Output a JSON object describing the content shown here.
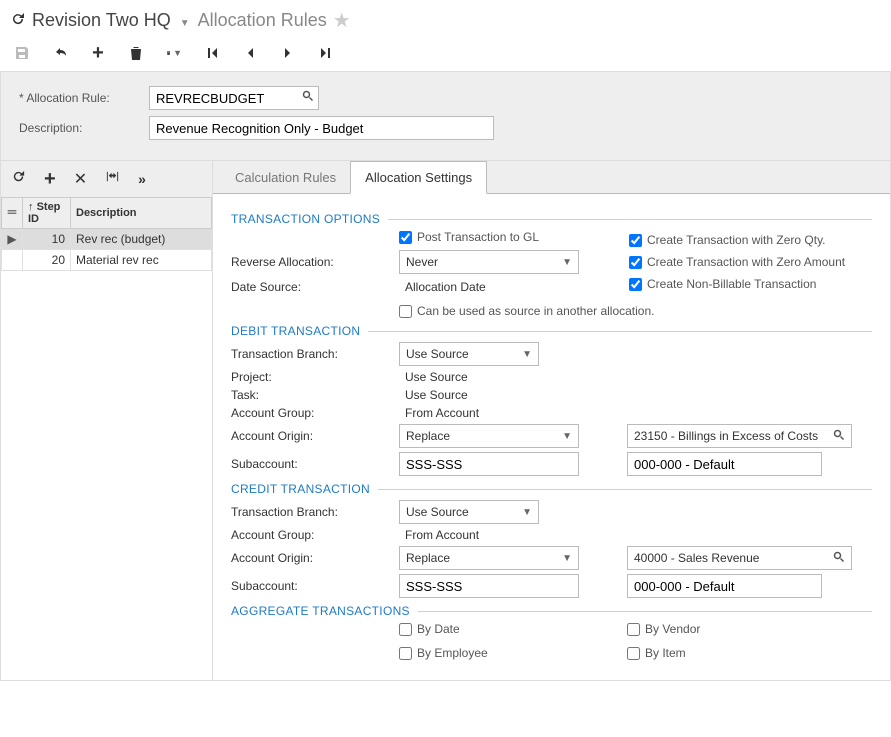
{
  "header": {
    "org": "Revision Two HQ",
    "page": "Allocation Rules"
  },
  "form": {
    "allocation_rule_label": "Allocation Rule:",
    "allocation_rule_value": "REVRECBUDGET",
    "description_label": "Description:",
    "description_value": "Revenue Recognition Only - Budget"
  },
  "grid": {
    "col_step": "Step ID",
    "col_desc": "Description",
    "rows": [
      {
        "step": "10",
        "desc": "Rev rec (budget)",
        "selected": true
      },
      {
        "step": "20",
        "desc": "Material rev rec",
        "selected": false
      }
    ]
  },
  "tabs": {
    "calc": "Calculation Rules",
    "alloc": "Allocation Settings"
  },
  "sections": {
    "transaction_options": "TRANSACTION OPTIONS",
    "debit": "DEBIT TRANSACTION",
    "credit": "CREDIT TRANSACTION",
    "aggregate": "AGGREGATE TRANSACTIONS"
  },
  "transaction_options": {
    "post_gl_label": "Post Transaction to GL",
    "post_gl_checked": true,
    "reverse_label": "Reverse Allocation:",
    "reverse_value": "Never",
    "date_source_label": "Date Source:",
    "date_source_value": "Allocation Date",
    "zero_qty_label": "Create Transaction with Zero Qty.",
    "zero_qty_checked": true,
    "zero_amount_label": "Create Transaction with Zero Amount",
    "zero_amount_checked": true,
    "nonbillable_label": "Create Non-Billable Transaction",
    "nonbillable_checked": true,
    "can_source_label": "Can be used as source in another allocation.",
    "can_source_checked": false
  },
  "debit": {
    "branch_label": "Transaction Branch:",
    "branch_value": "Use Source",
    "project_label": "Project:",
    "project_value": "Use Source",
    "task_label": "Task:",
    "task_value": "Use Source",
    "account_group_label": "Account Group:",
    "account_group_value": "From Account",
    "account_origin_label": "Account Origin:",
    "account_origin_value": "Replace",
    "account_value": "23150 - Billings in Excess of Costs",
    "subaccount_label": "Subaccount:",
    "subaccount_value": "SSS-SSS",
    "sub_default": "000-000 - Default"
  },
  "credit": {
    "branch_label": "Transaction Branch:",
    "branch_value": "Use Source",
    "account_group_label": "Account Group:",
    "account_group_value": "From Account",
    "account_origin_label": "Account Origin:",
    "account_origin_value": "Replace",
    "account_value": "40000 - Sales Revenue",
    "subaccount_label": "Subaccount:",
    "subaccount_value": "SSS-SSS",
    "sub_default": "000-000 - Default"
  },
  "aggregate": {
    "by_date": "By Date",
    "by_employee": "By Employee",
    "by_vendor": "By Vendor",
    "by_item": "By Item"
  }
}
